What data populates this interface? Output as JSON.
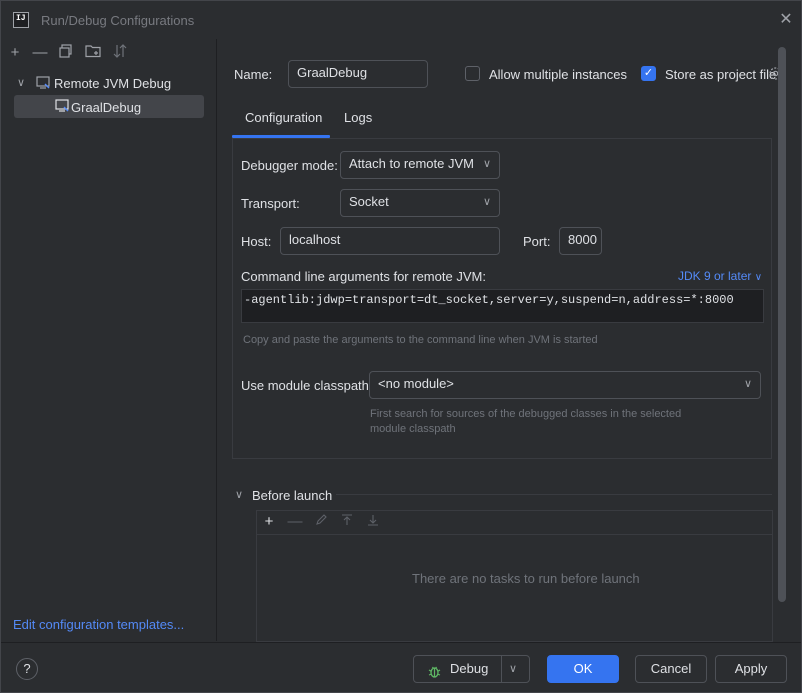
{
  "window": {
    "title": "Run/Debug Configurations",
    "app_icon_text": "IJ"
  },
  "left_toolbar": {
    "icons": [
      "add-icon",
      "remove-icon",
      "copy-icon",
      "new-folder-icon",
      "sort-icon"
    ]
  },
  "tree": {
    "group_label": "Remote JVM Debug",
    "item_label": "GraalDebug"
  },
  "left_footer": {
    "templates_link": "Edit configuration templates..."
  },
  "form": {
    "name_label": "Name:",
    "name_value": "GraalDebug",
    "allow_multiple_label": "Allow multiple instances",
    "allow_multiple_checked": false,
    "store_project_label": "Store as project file",
    "store_project_checked": true
  },
  "tabs": [
    {
      "label": "Configuration",
      "active": true
    },
    {
      "label": "Logs",
      "active": false
    }
  ],
  "config": {
    "debugger_mode_label": "Debugger mode:",
    "debugger_mode_value": "Attach to remote JVM",
    "transport_label": "Transport:",
    "transport_value": "Socket",
    "host_label": "Host:",
    "host_value": "localhost",
    "port_label": "Port:",
    "port_value": "8000",
    "cmd_label": "Command line arguments for remote JVM:",
    "jdk_link": "JDK 9 or later",
    "cmd_value": "-agentlib:jdwp=transport=dt_socket,server=y,suspend=n,address=*:8000",
    "cmd_hint": "Copy and paste the arguments to the command line when JVM is started",
    "classpath_label": "Use module classpath:",
    "classpath_value": "<no module>",
    "classpath_hint_1": "First search for sources of the debugged classes in the selected",
    "classpath_hint_2": "module classpath"
  },
  "before_launch": {
    "label": "Before launch",
    "empty_text": "There are no tasks to run before launch"
  },
  "footer": {
    "help": "?",
    "debug_label": "Debug",
    "ok_label": "OK",
    "cancel_label": "Cancel",
    "apply_label": "Apply"
  },
  "colors": {
    "accent": "#3574f0",
    "link": "#548af7",
    "background": "#2b2d30"
  }
}
